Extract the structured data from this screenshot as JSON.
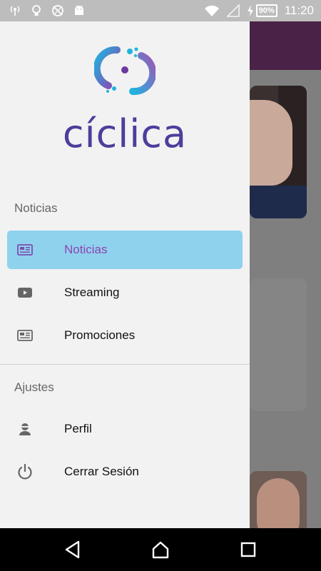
{
  "status_bar": {
    "battery_percent": "90%",
    "time": "11:20",
    "icons": [
      "wireless-icon",
      "lightbulb-icon",
      "no-sync-icon",
      "android-icon",
      "wifi-icon",
      "signal-icon",
      "charging-icon"
    ]
  },
  "drawer": {
    "brand": "cíclica",
    "brand_colors": {
      "text": "#4e3d9c",
      "purple": "#8e44ad",
      "blue": "#1fb3e0"
    },
    "section_news": "Noticias",
    "section_settings": "Ajustes",
    "items": [
      {
        "label": "Noticias",
        "icon": "newspaper-icon",
        "active": true
      },
      {
        "label": "Streaming",
        "icon": "play-icon",
        "active": false
      },
      {
        "label": "Promociones",
        "icon": "newspaper-icon",
        "active": false
      },
      {
        "label": "Perfil",
        "icon": "user-icon",
        "active": false
      },
      {
        "label": "Cerrar Sesión",
        "icon": "power-icon",
        "active": false
      }
    ],
    "active_color": "#8fd2ee"
  },
  "nav_bar": {
    "buttons": [
      "back-icon",
      "home-icon",
      "recents-icon"
    ]
  }
}
